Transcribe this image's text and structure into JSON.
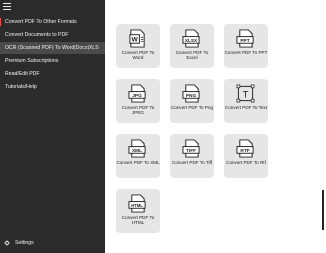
{
  "sidebar": {
    "items": [
      {
        "label": "Convert PDF To Other Formats"
      },
      {
        "label": "Convert Documents to PDF"
      },
      {
        "label": "OCR (Scanned PDF) To Word|Docx|XLS"
      },
      {
        "label": "Premium Subscriptions"
      },
      {
        "label": "Read/Edit PDF"
      },
      {
        "label": "Tutorials/Help"
      }
    ],
    "settings_label": "Settings"
  },
  "tiles": [
    {
      "icon_text": "W",
      "label": "Convert PDF To Word"
    },
    {
      "icon_text": "XLSX",
      "label": "Convert PDF To Excel"
    },
    {
      "icon_text": "PPT",
      "label": "Convert PDF To PPT"
    },
    {
      "icon_text": "JPG",
      "label": "Convert PDF To JPEG"
    },
    {
      "icon_text": "PNG",
      "label": "Convert PDF To Png"
    },
    {
      "icon_text": "T",
      "label": "Convert PDF To Text"
    },
    {
      "icon_text": "XML",
      "label": "Convert PDF To XML"
    },
    {
      "icon_text": "TIFF",
      "label": "Convert PDF To Tiff"
    },
    {
      "icon_text": "RTF",
      "label": "Convert PDF To Rtf"
    },
    {
      "icon_text": "HTML",
      "label": "Convert PDF To HTML"
    }
  ]
}
